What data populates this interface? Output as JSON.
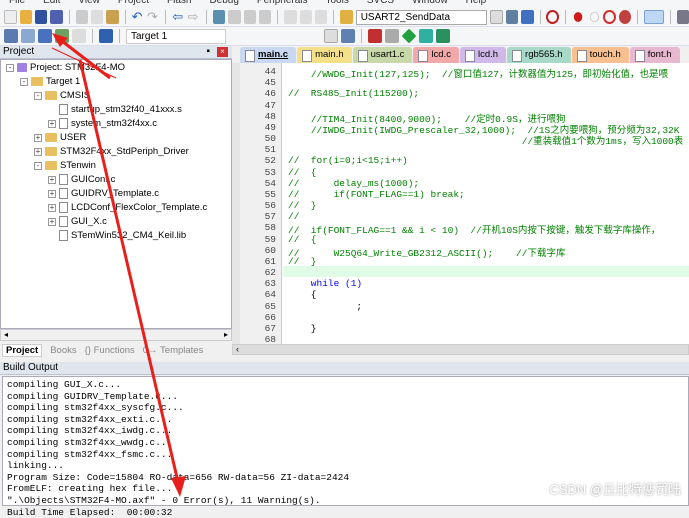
{
  "menu": [
    "File",
    "Edit",
    "View",
    "Project",
    "Flash",
    "Debug",
    "Peripherals",
    "Tools",
    "SVCS",
    "Window",
    "Help"
  ],
  "toolbar": {
    "function_combo": "USART2_SendData",
    "target_combo": "Target 1"
  },
  "project_panel": {
    "title": "Project",
    "tree": [
      {
        "label": "Project: STM32F4-MO",
        "level": 0,
        "toggle": "-",
        "kind": "project"
      },
      {
        "label": "Target 1",
        "level": 1,
        "toggle": "-",
        "kind": "folder"
      },
      {
        "label": "CMSIS",
        "level": 2,
        "toggle": "-",
        "kind": "folder"
      },
      {
        "label": "startup_stm32f40_41xxx.s",
        "level": 3,
        "toggle": "",
        "kind": "file"
      },
      {
        "label": "system_stm32f4xx.c",
        "level": 3,
        "toggle": "+",
        "kind": "file"
      },
      {
        "label": "USER",
        "level": 2,
        "toggle": "+",
        "kind": "folder"
      },
      {
        "label": "STM32F4xx_StdPeriph_Driver",
        "level": 2,
        "toggle": "+",
        "kind": "folder"
      },
      {
        "label": "STenwin",
        "level": 2,
        "toggle": "-",
        "kind": "folder"
      },
      {
        "label": "GUIConf.c",
        "level": 3,
        "toggle": "+",
        "kind": "file"
      },
      {
        "label": "GUIDRV_Template.c",
        "level": 3,
        "toggle": "+",
        "kind": "file"
      },
      {
        "label": "LCDConf_FlexColor_Template.c",
        "level": 3,
        "toggle": "+",
        "kind": "file"
      },
      {
        "label": "GUI_X.c",
        "level": 3,
        "toggle": "+",
        "kind": "file"
      },
      {
        "label": "STemWin532_CM4_Keil.lib",
        "level": 3,
        "toggle": "",
        "kind": "file"
      }
    ],
    "bottom_tabs": [
      "Project",
      "Books",
      "{} Functions",
      "0→ Templates"
    ]
  },
  "editor": {
    "tabs": [
      {
        "label": "main.c",
        "color": "#c8d8f0"
      },
      {
        "label": "main.h",
        "color": "#f5e08a"
      },
      {
        "label": "usart1.c",
        "color": "#c8d8a8"
      },
      {
        "label": "lcd.c",
        "color": "#f0a8a8"
      },
      {
        "label": "lcd.h",
        "color": "#d0b8e8"
      },
      {
        "label": "rgb565.h",
        "color": "#a8d8c8"
      },
      {
        "label": "touch.h",
        "color": "#f8c090"
      },
      {
        "label": "font.h",
        "color": "#e8b8d0"
      }
    ],
    "lines": [
      {
        "n": "44",
        "code": "    ",
        "cm": "//WWDG_Init(127,125);  //窗口值127，计数器值为125，即初始化值，也是喂"
      },
      {
        "n": "45",
        "code": "",
        "cm": ""
      },
      {
        "n": "46",
        "code": "",
        "cm": "//  RS485_Init(115200);"
      },
      {
        "n": "47",
        "code": "",
        "cm": ""
      },
      {
        "n": "48",
        "code": "    ",
        "cm": "//TIM4_Init(8400,9000);    //定时0.9S，进行喂狗"
      },
      {
        "n": "49",
        "code": "    ",
        "cm": "//IWDG_Init(IWDG_Prescaler_32,1000);  //1S之内要喂狗，预分频为32,32K"
      },
      {
        "n": "50",
        "code": "                                         ",
        "cm": "//重装载值1个数为1ms，写入1000表"
      },
      {
        "n": "51",
        "code": "",
        "cm": ""
      },
      {
        "n": "52",
        "code": "",
        "cm": "//  for(i=0;i<15;i++)"
      },
      {
        "n": "53",
        "code": "",
        "cm": "//  {"
      },
      {
        "n": "54",
        "code": "",
        "cm": "//      delay_ms(1000);"
      },
      {
        "n": "55",
        "code": "",
        "cm": "//      if(FONT_FLAG==1) break;"
      },
      {
        "n": "56",
        "code": "",
        "cm": "//  }"
      },
      {
        "n": "57",
        "code": "",
        "cm": "//"
      },
      {
        "n": "58",
        "code": "",
        "cm": "//  if(FONT_FLAG==1 && i < 10)  //开机10S内按下按键，触发下载字库操作，"
      },
      {
        "n": "59",
        "code": "",
        "cm": "//  {"
      },
      {
        "n": "60",
        "code": "",
        "cm": "//      W25Q64_Write_GB2312_ASCII();    //下载字库"
      },
      {
        "n": "61",
        "code": "",
        "cm": "//  }"
      },
      {
        "n": "62",
        "code": "",
        "cm": ""
      },
      {
        "n": "63",
        "code": "    while (1)",
        "cm": ""
      },
      {
        "n": "64",
        "code": "    {",
        "cm": ""
      },
      {
        "n": "65",
        "code": "            ;",
        "cm": ""
      },
      {
        "n": "66",
        "code": "",
        "cm": ""
      },
      {
        "n": "67",
        "code": "    }",
        "cm": ""
      },
      {
        "n": "68",
        "code": "",
        "cm": ""
      }
    ]
  },
  "build_output": {
    "title": "Build Output",
    "lines": [
      "compiling GUI_X.c...",
      "compiling GUIDRV_Template.c...",
      "compiling stm32f4xx_syscfg.c...",
      "compiling stm32f4xx_exti.c...",
      "compiling stm32f4xx_iwdg.c...",
      "compiling stm32f4xx_wwdg.c...",
      "compiling stm32f4xx_fsmc.c...",
      "linking...",
      "Program Size: Code=15804 RO-data=656 RW-data=56 ZI-data=2424",
      "FromELF: creating hex file...",
      "\".\\Objects\\STM32F4-MO.axf\" - 0 Error(s), 11 Warning(s).",
      "Build Time Elapsed:  00:00:32"
    ]
  },
  "watermark": "CSDN @丘比特惩罚陆",
  "colors": {
    "annotation": "#e8201c",
    "current_line": "#e0fbe6"
  }
}
